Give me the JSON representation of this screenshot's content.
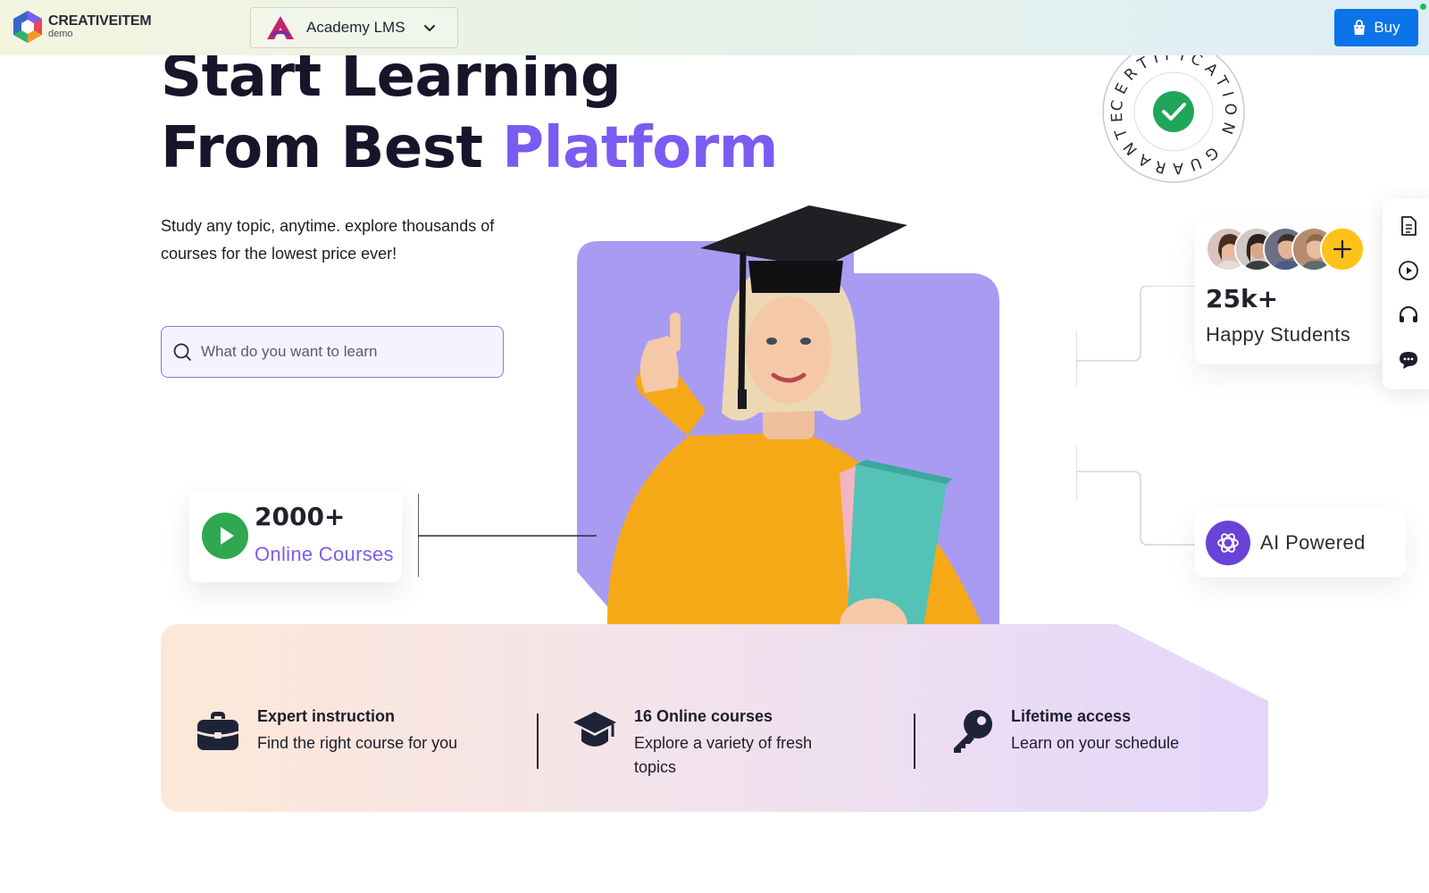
{
  "header": {
    "brand_name": "CREATIVEITEM",
    "brand_sub": "demo",
    "product_name": "Academy LMS",
    "buy_label": "Buy"
  },
  "hero": {
    "title_line1": "Start Learning",
    "title_line2_prefix": "From Best ",
    "title_line2_accent": "Platform",
    "description": "Study any topic, anytime. explore thousands of courses for the lowest price ever!",
    "search_placeholder": "What do you want to learn"
  },
  "badge": {
    "text": "CERTIFICATION GUARANTEE"
  },
  "stats": {
    "courses_count": "2000+",
    "courses_label": "Online Courses",
    "students_count": "25k+",
    "students_label": "Happy Students",
    "ai_label": "AI Powered"
  },
  "features": [
    {
      "title": "Expert instruction",
      "desc": "Find the right course for you",
      "icon": "briefcase-icon"
    },
    {
      "title": "16 Online courses",
      "desc": "Explore a variety of fresh topics",
      "icon": "graduation-cap-icon"
    },
    {
      "title": "Lifetime access",
      "desc": "Learn on your schedule",
      "icon": "key-icon"
    }
  ],
  "side_toolbar": [
    "document-icon",
    "play-circle-icon",
    "headset-icon",
    "chat-icon"
  ],
  "colors": {
    "accent": "#7b5cf2",
    "buy_button": "#0b74e8",
    "play_green": "#2fa84f",
    "ai_purple": "#6a42d8",
    "plus_yellow": "#ffc21a",
    "hero_panel": "#a99bf2"
  }
}
